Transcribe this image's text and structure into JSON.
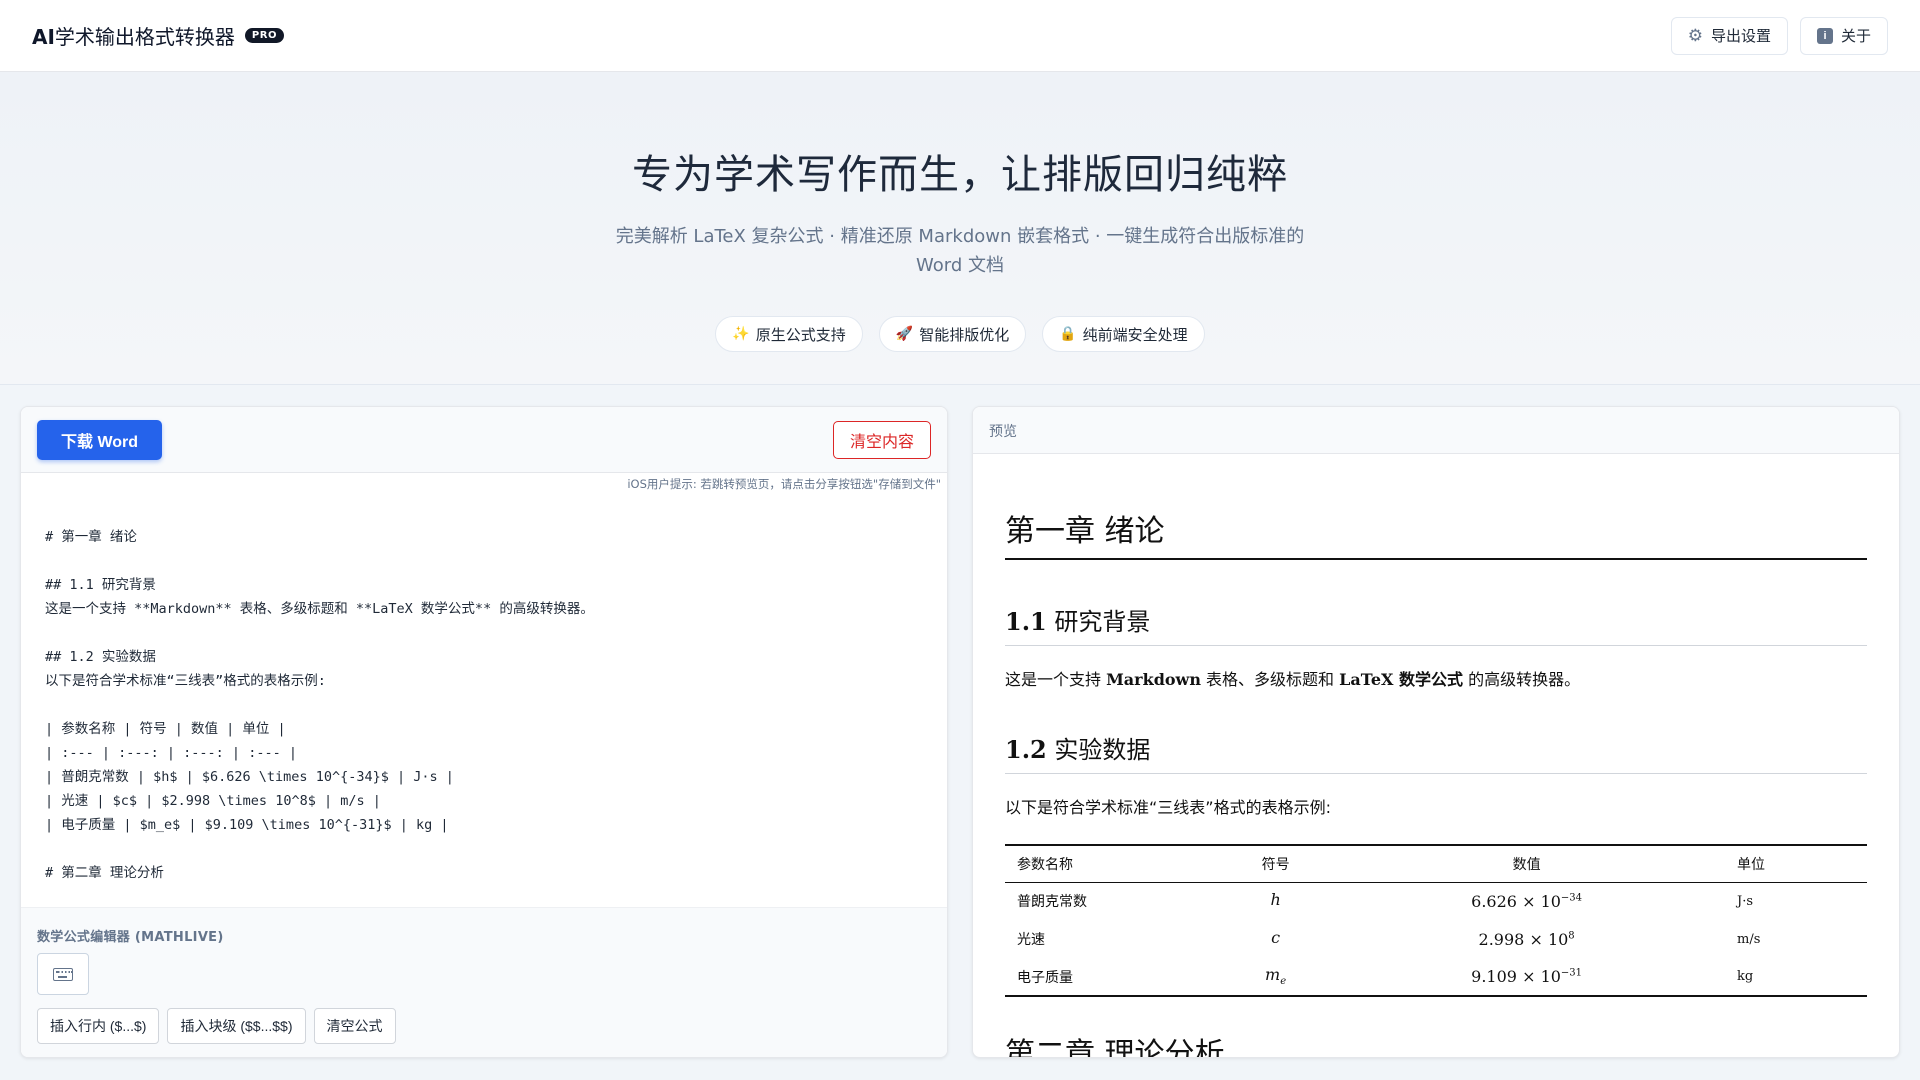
{
  "header": {
    "brand_bold": "AI",
    "brand_rest": "学术输出格式转换器",
    "badge": "PRO",
    "export_settings_label": "导出设置",
    "about_label": "关于",
    "about_icon_glyph": "i"
  },
  "hero": {
    "title": "专为学术写作而生，让排版回归纯粹",
    "subtitle": "完美解析 LaTeX 复杂公式 · 精准还原 Markdown 嵌套格式 · 一键生成符合出版标准的 Word 文档",
    "features": [
      {
        "icon": "sparkles-icon",
        "emoji": "✨",
        "label": "原生公式支持"
      },
      {
        "icon": "rocket-icon",
        "emoji": "🚀",
        "label": "智能排版优化"
      },
      {
        "icon": "lock-icon",
        "emoji": "🔒",
        "label": "纯前端安全处理"
      }
    ]
  },
  "editor": {
    "download_label": "下载 Word",
    "clear_label": "清空内容",
    "ios_hint": "iOS用户提示: 若跳转预览页，请点击分享按钮选\"存储到文件\"",
    "content": "# 第一章 绪论\n\n## 1.1 研究背景\n这是一个支持 **Markdown** 表格、多级标题和 **LaTeX 数学公式** 的高级转换器。\n\n## 1.2 实验数据\n以下是符合学术标准“三线表”格式的表格示例:\n\n| 参数名称 | 符号 | 数值 | 单位 |\n| :--- | :---: | :---: | :--- |\n| 普朗克常数 | $h$ | $6.626 \\times 10^{-34}$ | J·s |\n| 光速 | $c$ | $2.998 \\times 10^8$ | m/s |\n| 电子质量 | $m_e$ | $9.109 \\times 10^{-31}$ | kg |\n\n# 第二章 理论分析",
    "math_label": "数学公式编辑器 (MATHLIVE)",
    "math_buttons": {
      "inline": "插入行内 ($...$)",
      "block": "插入块级 ($$...$$)",
      "clear": "清空公式"
    }
  },
  "preview": {
    "header_label": "预览",
    "h1": "第一章 绪论",
    "sec1_num": "1.1",
    "sec1_title": "研究背景",
    "para1": {
      "pre": "这是一个支持 ",
      "b1": "Markdown",
      "mid": " 表格、多级标题和 ",
      "b2": "LaTeX",
      "mid2": " 数学公式",
      "post": " 的高级转换器。"
    },
    "sec2_num": "1.2",
    "sec2_title": "实验数据",
    "para2": "以下是符合学术标准“三线表”格式的表格示例:",
    "table": {
      "headers": [
        "参数名称",
        "符号",
        "数值",
        "单位"
      ],
      "rows": [
        {
          "name": "普朗克常数",
          "symbol": "h",
          "symbol_sub": "",
          "mantissa": "6.626",
          "times": "×",
          "base": "10",
          "exp": "−34",
          "unit": "J·s"
        },
        {
          "name": "光速",
          "symbol": "c",
          "symbol_sub": "",
          "mantissa": "2.998",
          "times": "×",
          "base": "10",
          "exp": "8",
          "unit": "m/s"
        },
        {
          "name": "电子质量",
          "symbol": "m",
          "symbol_sub": "e",
          "mantissa": "9.109",
          "times": "×",
          "base": "10",
          "exp": "−31",
          "unit": "kg"
        }
      ]
    },
    "h1_second": "第二章 理论分析"
  }
}
